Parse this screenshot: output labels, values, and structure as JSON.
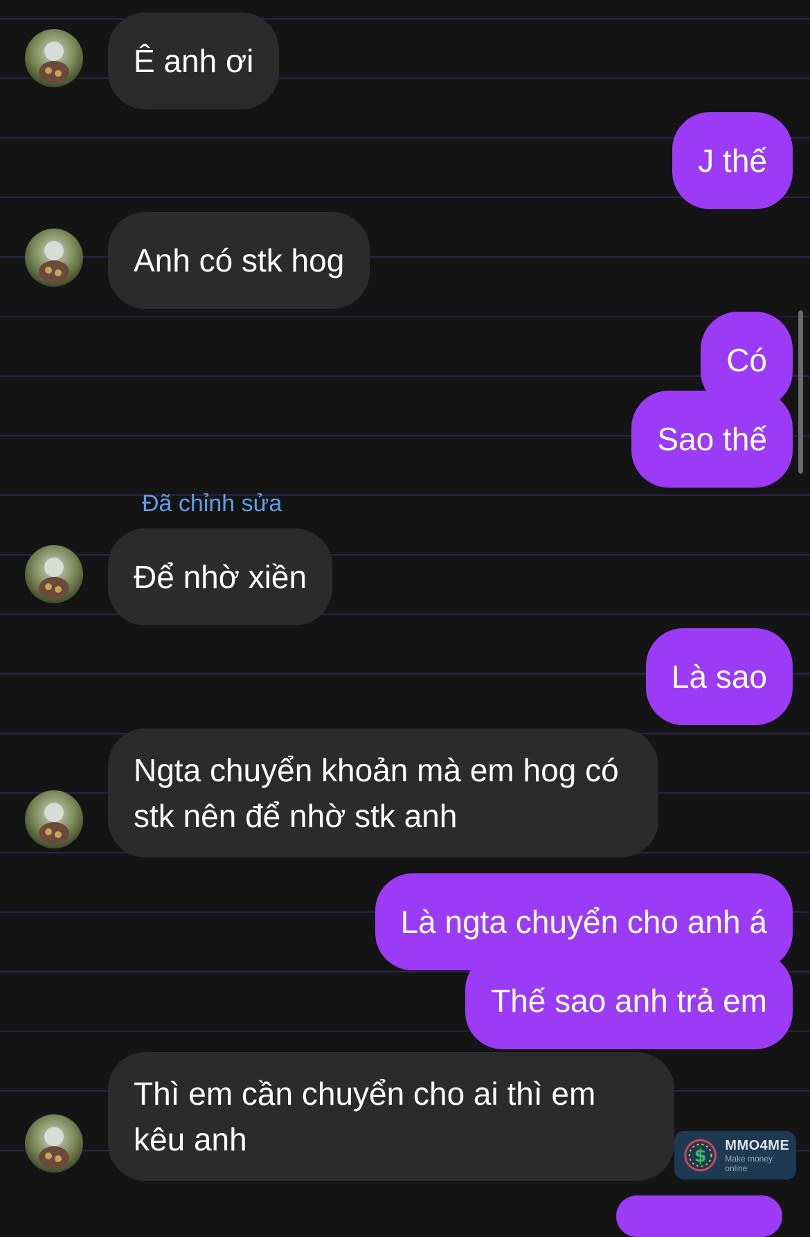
{
  "messages": [
    {
      "from": "them",
      "text": "Ê anh ơi"
    },
    {
      "from": "me",
      "text": "J thế"
    },
    {
      "from": "them",
      "text": "Anh có stk hog"
    },
    {
      "from": "me",
      "text": "Có"
    },
    {
      "from": "me",
      "text": "Sao thế"
    },
    {
      "from": "them",
      "text": "Để nhờ xiền",
      "note": "Đã chỉnh sửa"
    },
    {
      "from": "me",
      "text": "Là sao"
    },
    {
      "from": "them",
      "text": "Ngta chuyển khoản mà em hog có stk nên để nhờ stk anh"
    },
    {
      "from": "me",
      "text": "Là ngta chuyển cho anh á"
    },
    {
      "from": "me",
      "text": "Thế sao anh trả em"
    },
    {
      "from": "them",
      "text": "Thì em cần chuyển cho ai thì em kêu anh"
    }
  ],
  "watermark": {
    "name": "MMO4ME",
    "tagline": "Make money online",
    "symbol": "$"
  },
  "colors": {
    "background": "#141414",
    "incoming_bubble": "#2b2b2b",
    "outgoing_bubble": "#9b3bf6",
    "edited_label": "#5e9de8",
    "ruled_line": "#2b2550"
  }
}
